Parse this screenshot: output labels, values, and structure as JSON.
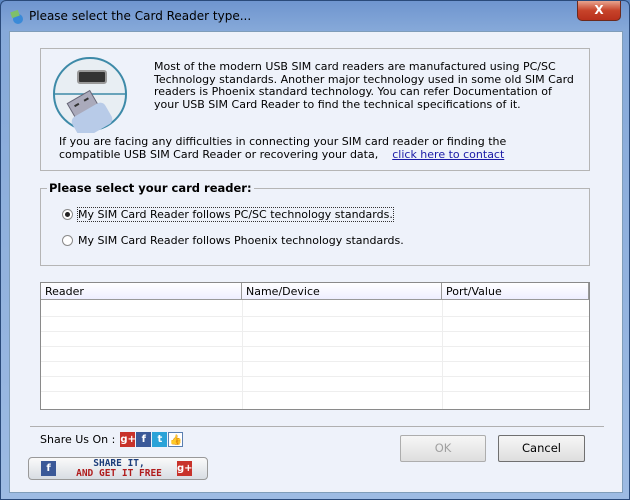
{
  "window": {
    "title": "Please select the Card Reader type...",
    "close_label": "X"
  },
  "info": {
    "paragraph": "Most of the modern USB SIM card readers are manufactured using PC/SC Technology standards. Another major technology used in some old SIM Card readers is Phoenix standard technology. You can refer Documentation of your USB SIM Card Reader to find the technical specifications of it.",
    "contact_text": "If you are facing any difficulties in connecting your SIM card reader or finding the compatible USB SIM Card Reader or recovering your data,",
    "contact_link": "click here to contact"
  },
  "reader_group": {
    "label": "Please select your card reader:",
    "options": [
      {
        "label": "My SIM Card Reader follows PC/SC technology standards.",
        "selected": true
      },
      {
        "label": "My SIM Card Reader follows Phoenix technology standards.",
        "selected": false
      }
    ]
  },
  "table": {
    "columns": [
      "Reader",
      "Name/Device",
      "Port/Value"
    ],
    "rows": []
  },
  "share": {
    "label": "Share Us On :",
    "button_line1": "SHARE IT,",
    "button_line2": "AND GET IT FREE",
    "icons": [
      "google-plus-icon",
      "facebook-icon",
      "twitter-icon",
      "like-icon"
    ]
  },
  "buttons": {
    "ok": "OK",
    "cancel": "Cancel"
  }
}
